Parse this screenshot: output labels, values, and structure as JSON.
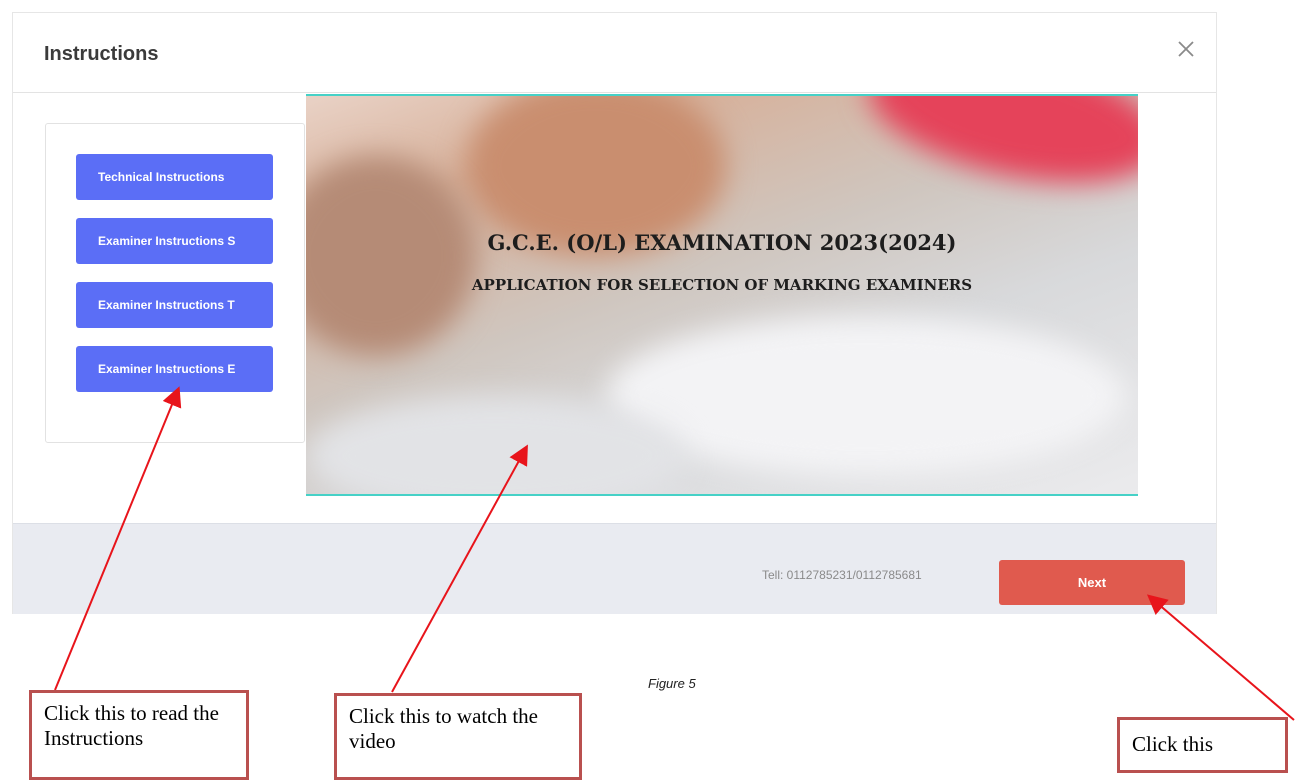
{
  "modal": {
    "title": "Instructions",
    "close_icon": "close-icon"
  },
  "sidebar": {
    "buttons": [
      {
        "label": "Technical Instructions"
      },
      {
        "label": "Examiner Instructions S"
      },
      {
        "label": "Examiner Instructions T"
      },
      {
        "label": "Examiner Instructions E"
      }
    ]
  },
  "video": {
    "title_line1": "G.C.E. (O/L) EXAMINATION 2023(2024)",
    "title_line2": "APPLICATION FOR SELECTION OF MARKING EXAMINERS"
  },
  "footer": {
    "tell": "Tell: 0112785231/0112785681",
    "next_label": "Next"
  },
  "figure_caption": "Figure 5",
  "annotations": {
    "instructions_callout": "Click this to read the Instructions",
    "video_callout": "Click this to watch the video",
    "next_callout": "Click this"
  },
  "colors": {
    "side_button": "#5b6ef6",
    "next_button": "#e05a4e",
    "footer_bg": "#e9ebf1",
    "video_border": "#46d1c7",
    "arrow": "#e8141b",
    "callout_border": "#b9504f"
  }
}
